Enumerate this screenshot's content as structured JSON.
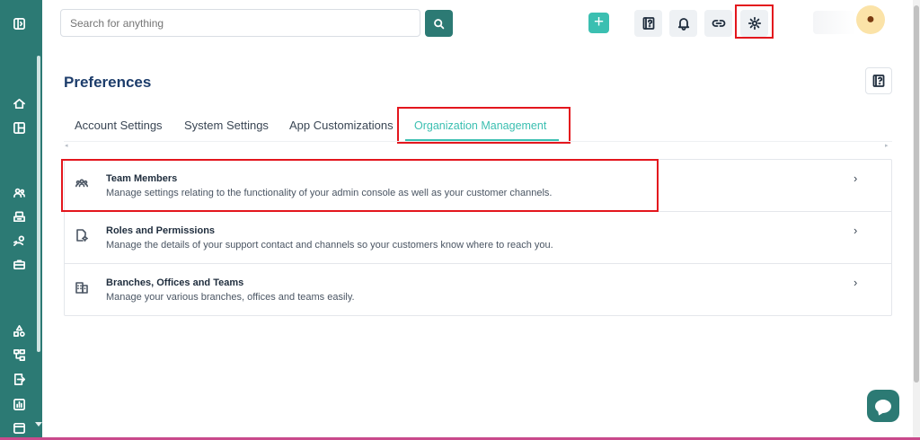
{
  "header": {
    "search_placeholder": "Search for anything",
    "plus_label": "+",
    "avatar_glyph": "●"
  },
  "sidebar": {
    "icons": [
      "panel-toggle-icon",
      "home-icon",
      "layout-icon",
      "users-icon",
      "inbox-icon",
      "customer-settings-icon",
      "briefcase-icon",
      "shapes-icon",
      "org-icon",
      "export-icon",
      "report-icon",
      "calendar-icon"
    ]
  },
  "page": {
    "title": "Preferences"
  },
  "tabs": [
    {
      "label": "Account Settings",
      "active": false
    },
    {
      "label": "System Settings",
      "active": false
    },
    {
      "label": "App Customizations",
      "active": false
    },
    {
      "label": "Organization Management",
      "active": true
    }
  ],
  "tab_scroll": {
    "left": "◂",
    "right": "▸"
  },
  "items": [
    {
      "title": "Team Members",
      "description": "Manage settings relating to the functionality of your admin console as well as your customer channels.",
      "icon": "team-icon"
    },
    {
      "title": "Roles and Permissions",
      "description": "Manage the details of your support contact and channels so your customers know where to reach you.",
      "icon": "roles-icon"
    },
    {
      "title": "Branches, Offices and Teams",
      "description": "Manage your various branches, offices and teams easily.",
      "icon": "building-icon"
    }
  ],
  "chevron": "›",
  "colors": {
    "brand": "#2c7a74",
    "accent": "#3bbfb1",
    "highlight": "#e3161d",
    "title": "#1d3d6b"
  }
}
